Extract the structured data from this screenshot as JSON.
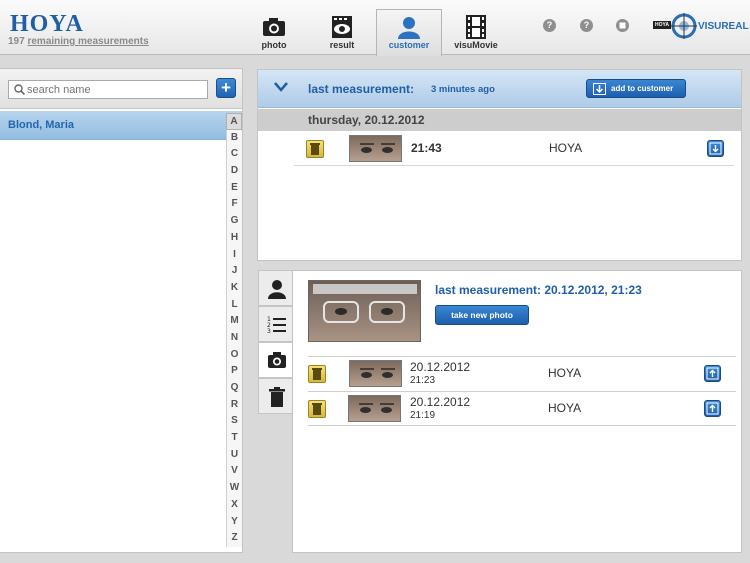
{
  "header": {
    "logo": "HOYA",
    "remaining_count": "197",
    "remaining_label": "remaining measurements",
    "tabs": [
      {
        "label": "photo",
        "icon": "camera-icon"
      },
      {
        "label": "result",
        "icon": "eye-film-icon"
      },
      {
        "label": "customer",
        "icon": "person-icon",
        "active": true
      },
      {
        "label": "visuMovie",
        "icon": "film-strip-icon"
      }
    ],
    "help_icons": [
      "?",
      "?"
    ],
    "brand_small": "HOYA",
    "brand_name": "VISUREAL"
  },
  "sidebar": {
    "search_placeholder": "search name",
    "add_label": "+",
    "selected_customer": "Blond, Maria",
    "alphabet": [
      "A",
      "B",
      "C",
      "D",
      "E",
      "F",
      "G",
      "H",
      "I",
      "J",
      "K",
      "L",
      "M",
      "N",
      "O",
      "P",
      "Q",
      "R",
      "S",
      "T",
      "U",
      "V",
      "W",
      "X",
      "Y",
      "Z"
    ]
  },
  "latest": {
    "title": "last measurement:",
    "ago": "3 minutes ago",
    "add_button": "add to customer",
    "date_header": "thursday, 20.12.2012",
    "row": {
      "time": "21:43",
      "brand": "HOYA"
    }
  },
  "customer_panel": {
    "last_measurement": "last measurement: 20.12.2012, 21:23",
    "take_photo_button": "take new photo",
    "measurements": [
      {
        "date": "20.12.2012",
        "time": "21:23",
        "brand": "HOYA"
      },
      {
        "date": "20.12.2012",
        "time": "21:19",
        "brand": "HOYA"
      }
    ]
  },
  "colors": {
    "accent": "#1f5ea8",
    "button": "#2a72c2",
    "selected_row": "#a8cbe9"
  }
}
